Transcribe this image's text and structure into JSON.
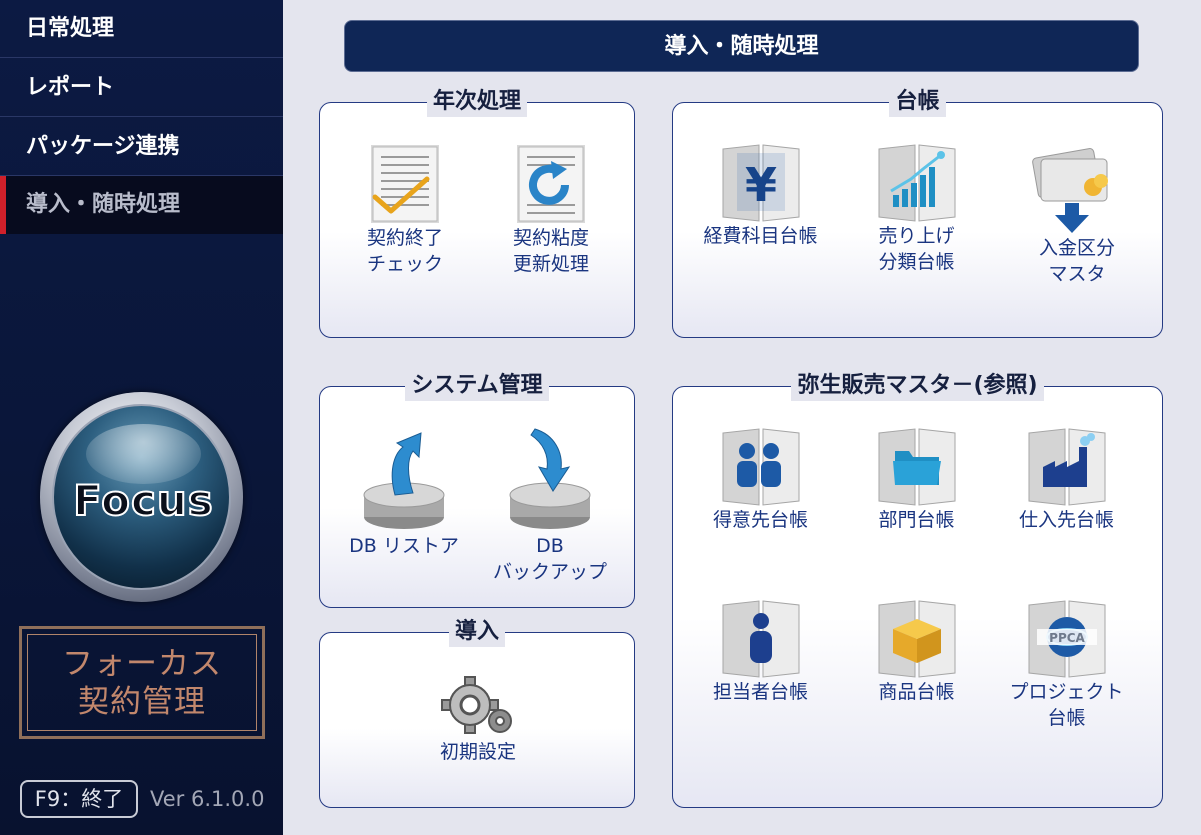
{
  "sidebar": {
    "items": [
      {
        "label": "日常処理"
      },
      {
        "label": "レポート"
      },
      {
        "label": "パッケージ連携"
      },
      {
        "label": "導入・随時処理"
      }
    ],
    "logo_text": "Focus",
    "brand_line1": "フォーカス",
    "brand_line2": "契約管理",
    "f9_label": "F9：終了",
    "version": "Ver 6.1.0.0"
  },
  "header": {
    "title": "導入・随時処理"
  },
  "groups": {
    "annual": {
      "title": "年次処理",
      "tiles": [
        {
          "label": "契約終了\nチェック",
          "icon": "document-check-icon"
        },
        {
          "label": "契約粘度\n更新処理",
          "icon": "document-refresh-icon"
        }
      ]
    },
    "ledger": {
      "title": "台帳",
      "tiles": [
        {
          "label": "経費科目台帳",
          "icon": "yen-ledger-icon"
        },
        {
          "label": "売り上げ\n分類台帳",
          "icon": "sales-chart-ledger-icon"
        },
        {
          "label": "入金区分\nマスタ",
          "icon": "payment-card-icon"
        }
      ]
    },
    "system": {
      "title": "システム管理",
      "tiles": [
        {
          "label": "DB リストア",
          "icon": "database-restore-icon"
        },
        {
          "label": "DB\nバックアップ",
          "icon": "database-backup-icon"
        }
      ]
    },
    "intro": {
      "title": "導入",
      "tiles": [
        {
          "label": "初期設定",
          "icon": "gear-settings-icon"
        }
      ]
    },
    "yayoi": {
      "title": "弥生販売マスタ－(参照)",
      "tiles": [
        {
          "label": "得意先台帳",
          "icon": "customers-ledger-icon"
        },
        {
          "label": "部門台帳",
          "icon": "folder-ledger-icon"
        },
        {
          "label": "仕入先台帳",
          "icon": "factory-ledger-icon"
        },
        {
          "label": "担当者台帳",
          "icon": "person-ledger-icon"
        },
        {
          "label": "商品台帳",
          "icon": "box-ledger-icon"
        },
        {
          "label": "プロジェクト\n台帳",
          "icon": "ppca-ledger-icon"
        }
      ]
    }
  },
  "colors": {
    "sidebar_bg": "#0c1a43",
    "header_bg": "#0f2656",
    "active_marker": "#d0202a",
    "tile_label": "#1a3580",
    "icon_blue": "#1d5aa6",
    "brand": "#c2876c"
  }
}
